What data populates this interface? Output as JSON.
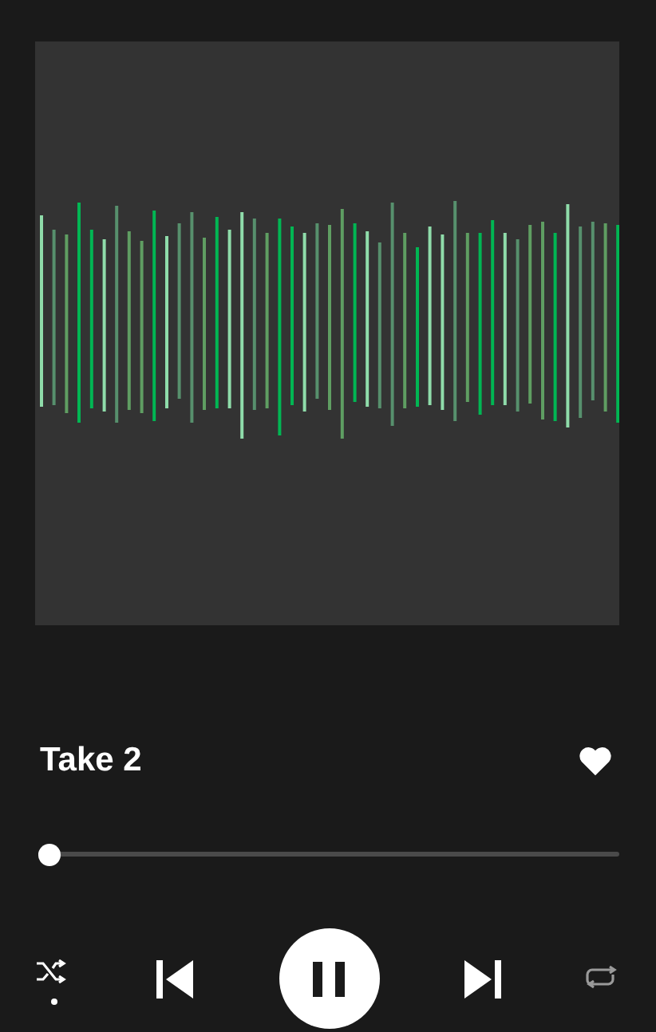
{
  "track": {
    "title": "Take 2",
    "liked": true
  },
  "progress": {
    "level": 0.02
  },
  "controls": {
    "shuffle": {
      "on": true
    },
    "playing": true,
    "repeat": {
      "on": false
    }
  }
}
